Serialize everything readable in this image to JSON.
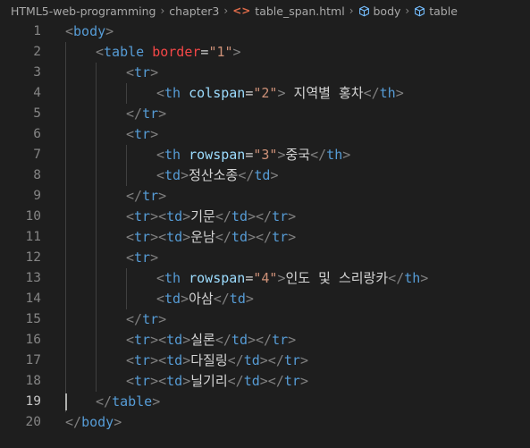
{
  "breadcrumb": {
    "folder": "HTML5-web-programming",
    "subfolder": "chapter3",
    "file": "table_span.html",
    "symbol1": "body",
    "symbol2": "table",
    "separator": "›",
    "code_icon": "<>"
  },
  "colors": {
    "background": "#1e1e1e",
    "tag": "#569cd6",
    "attribute": "#9cdcfe",
    "string": "#ce9178",
    "text": "#d4d4d4",
    "bracket": "#808080"
  },
  "editor": {
    "active_line": 19,
    "lines": [
      {
        "n": "1",
        "indent": 0,
        "tokens": [
          [
            "br",
            "<"
          ],
          [
            "tag",
            "body"
          ],
          [
            "br",
            ">"
          ]
        ]
      },
      {
        "n": "2",
        "indent": 1,
        "tokens": [
          [
            "br",
            "<"
          ],
          [
            "tag",
            "table"
          ],
          [
            "txt",
            " "
          ],
          [
            "attr-red",
            "border"
          ],
          [
            "eq",
            "="
          ],
          [
            "str",
            "\"1\""
          ],
          [
            "br",
            ">"
          ]
        ]
      },
      {
        "n": "3",
        "indent": 2,
        "tokens": [
          [
            "br",
            "<"
          ],
          [
            "tag",
            "tr"
          ],
          [
            "br",
            ">"
          ]
        ]
      },
      {
        "n": "4",
        "indent": 3,
        "tokens": [
          [
            "br",
            "<"
          ],
          [
            "tag",
            "th"
          ],
          [
            "txt",
            " "
          ],
          [
            "attr",
            "colspan"
          ],
          [
            "eq",
            "="
          ],
          [
            "str",
            "\"2\""
          ],
          [
            "br",
            ">"
          ],
          [
            "txt",
            " 지역별 홍차"
          ],
          [
            "br",
            "</"
          ],
          [
            "tag",
            "th"
          ],
          [
            "br",
            ">"
          ]
        ]
      },
      {
        "n": "5",
        "indent": 2,
        "tokens": [
          [
            "br",
            "</"
          ],
          [
            "tag",
            "tr"
          ],
          [
            "br",
            ">"
          ]
        ]
      },
      {
        "n": "6",
        "indent": 2,
        "tokens": [
          [
            "br",
            "<"
          ],
          [
            "tag",
            "tr"
          ],
          [
            "br",
            ">"
          ]
        ]
      },
      {
        "n": "7",
        "indent": 3,
        "tokens": [
          [
            "br",
            "<"
          ],
          [
            "tag",
            "th"
          ],
          [
            "txt",
            " "
          ],
          [
            "attr",
            "rowspan"
          ],
          [
            "eq",
            "="
          ],
          [
            "str",
            "\"3\""
          ],
          [
            "br",
            ">"
          ],
          [
            "txt",
            "중국"
          ],
          [
            "br",
            "</"
          ],
          [
            "tag",
            "th"
          ],
          [
            "br",
            ">"
          ]
        ]
      },
      {
        "n": "8",
        "indent": 3,
        "tokens": [
          [
            "br",
            "<"
          ],
          [
            "tag",
            "td"
          ],
          [
            "br",
            ">"
          ],
          [
            "txt",
            "정산소종"
          ],
          [
            "br",
            "</"
          ],
          [
            "tag",
            "td"
          ],
          [
            "br",
            ">"
          ]
        ]
      },
      {
        "n": "9",
        "indent": 2,
        "tokens": [
          [
            "br",
            "</"
          ],
          [
            "tag",
            "tr"
          ],
          [
            "br",
            ">"
          ]
        ]
      },
      {
        "n": "10",
        "indent": 2,
        "tokens": [
          [
            "br",
            "<"
          ],
          [
            "tag",
            "tr"
          ],
          [
            "br",
            "><"
          ],
          [
            "tag",
            "td"
          ],
          [
            "br",
            ">"
          ],
          [
            "txt",
            "기문"
          ],
          [
            "br",
            "</"
          ],
          [
            "tag",
            "td"
          ],
          [
            "br",
            "></"
          ],
          [
            "tag",
            "tr"
          ],
          [
            "br",
            ">"
          ]
        ]
      },
      {
        "n": "11",
        "indent": 2,
        "tokens": [
          [
            "br",
            "<"
          ],
          [
            "tag",
            "tr"
          ],
          [
            "br",
            "><"
          ],
          [
            "tag",
            "td"
          ],
          [
            "br",
            ">"
          ],
          [
            "txt",
            "운남"
          ],
          [
            "br",
            "</"
          ],
          [
            "tag",
            "td"
          ],
          [
            "br",
            "></"
          ],
          [
            "tag",
            "tr"
          ],
          [
            "br",
            ">"
          ]
        ]
      },
      {
        "n": "12",
        "indent": 2,
        "tokens": [
          [
            "br",
            "<"
          ],
          [
            "tag",
            "tr"
          ],
          [
            "br",
            ">"
          ]
        ]
      },
      {
        "n": "13",
        "indent": 3,
        "tokens": [
          [
            "br",
            "<"
          ],
          [
            "tag",
            "th"
          ],
          [
            "txt",
            " "
          ],
          [
            "attr",
            "rowspan"
          ],
          [
            "eq",
            "="
          ],
          [
            "str",
            "\"4\""
          ],
          [
            "br",
            ">"
          ],
          [
            "txt",
            "인도 및 스리랑카"
          ],
          [
            "br",
            "</"
          ],
          [
            "tag",
            "th"
          ],
          [
            "br",
            ">"
          ]
        ]
      },
      {
        "n": "14",
        "indent": 3,
        "tokens": [
          [
            "br",
            "<"
          ],
          [
            "tag",
            "td"
          ],
          [
            "br",
            ">"
          ],
          [
            "txt",
            "아삼"
          ],
          [
            "br",
            "</"
          ],
          [
            "tag",
            "td"
          ],
          [
            "br",
            ">"
          ]
        ]
      },
      {
        "n": "15",
        "indent": 2,
        "tokens": [
          [
            "br",
            "</"
          ],
          [
            "tag",
            "tr"
          ],
          [
            "br",
            ">"
          ]
        ]
      },
      {
        "n": "16",
        "indent": 2,
        "tokens": [
          [
            "br",
            "<"
          ],
          [
            "tag",
            "tr"
          ],
          [
            "br",
            "><"
          ],
          [
            "tag",
            "td"
          ],
          [
            "br",
            ">"
          ],
          [
            "txt",
            "실론"
          ],
          [
            "br",
            "</"
          ],
          [
            "tag",
            "td"
          ],
          [
            "br",
            "></"
          ],
          [
            "tag",
            "tr"
          ],
          [
            "br",
            ">"
          ]
        ]
      },
      {
        "n": "17",
        "indent": 2,
        "tokens": [
          [
            "br",
            "<"
          ],
          [
            "tag",
            "tr"
          ],
          [
            "br",
            "><"
          ],
          [
            "tag",
            "td"
          ],
          [
            "br",
            ">"
          ],
          [
            "txt",
            "다질링"
          ],
          [
            "br",
            "</"
          ],
          [
            "tag",
            "td"
          ],
          [
            "br",
            "></"
          ],
          [
            "tag",
            "tr"
          ],
          [
            "br",
            ">"
          ]
        ]
      },
      {
        "n": "18",
        "indent": 2,
        "tokens": [
          [
            "br",
            "<"
          ],
          [
            "tag",
            "tr"
          ],
          [
            "br",
            "><"
          ],
          [
            "tag",
            "td"
          ],
          [
            "br",
            ">"
          ],
          [
            "txt",
            "닐기리"
          ],
          [
            "br",
            "</"
          ],
          [
            "tag",
            "td"
          ],
          [
            "br",
            "></"
          ],
          [
            "tag",
            "tr"
          ],
          [
            "br",
            ">"
          ]
        ]
      },
      {
        "n": "19",
        "indent": 1,
        "tokens": [
          [
            "br",
            "</"
          ],
          [
            "tag",
            "table"
          ],
          [
            "br",
            ">"
          ]
        ]
      },
      {
        "n": "20",
        "indent": 0,
        "tokens": [
          [
            "br",
            "</"
          ],
          [
            "tag",
            "body"
          ],
          [
            "br",
            ">"
          ]
        ]
      }
    ]
  }
}
